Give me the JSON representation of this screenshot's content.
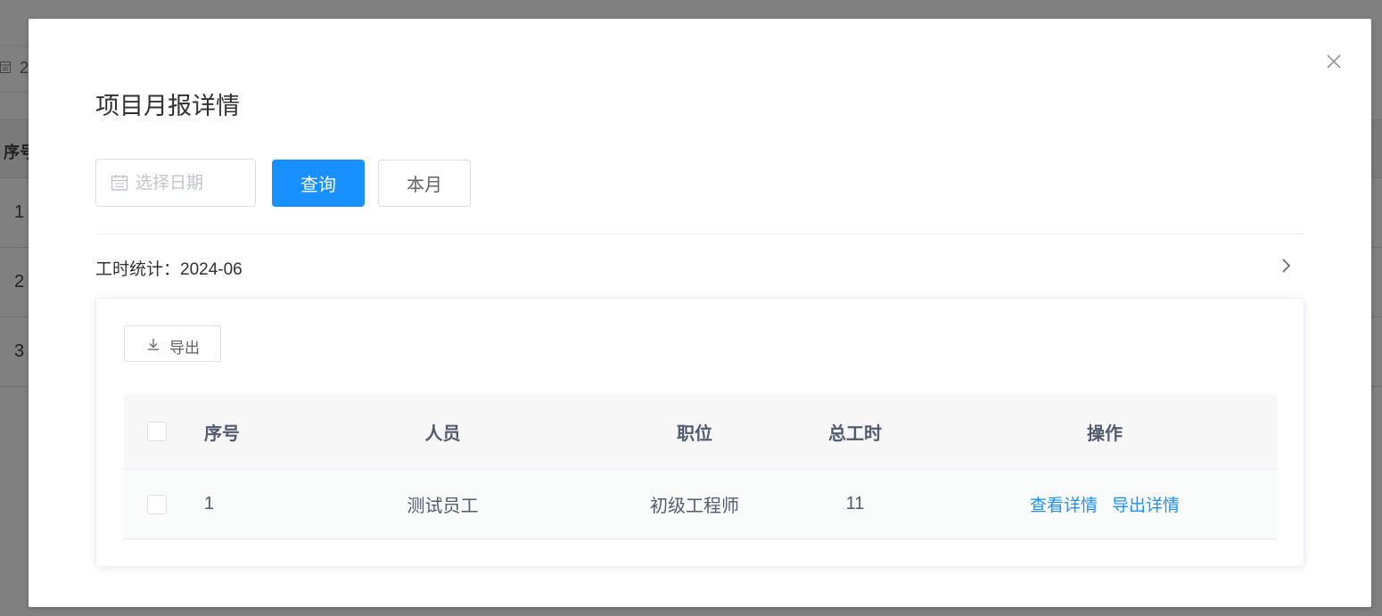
{
  "background": {
    "date_partial": "2",
    "header_label": "序号",
    "rows": [
      "1",
      "2",
      "3"
    ]
  },
  "dialog": {
    "title": "项目月报详情",
    "close_icon": "close-icon"
  },
  "filters": {
    "date_placeholder": "选择日期",
    "query_label": "查询",
    "month_label": "本月"
  },
  "section": {
    "title": "工时统计：2024-06",
    "arrow_icon": "chevron-right-icon"
  },
  "toolbar": {
    "export_label": "导出",
    "export_icon": "download-icon"
  },
  "table": {
    "columns": [
      "序号",
      "人员",
      "职位",
      "总工时",
      "操作"
    ],
    "rows": [
      {
        "index": "1",
        "person": "测试员工",
        "position": "初级工程师",
        "total_hours": "11",
        "actions": [
          "查看详情",
          "导出详情"
        ]
      }
    ]
  },
  "colors": {
    "primary": "#1890ff",
    "mask": "#808080"
  }
}
